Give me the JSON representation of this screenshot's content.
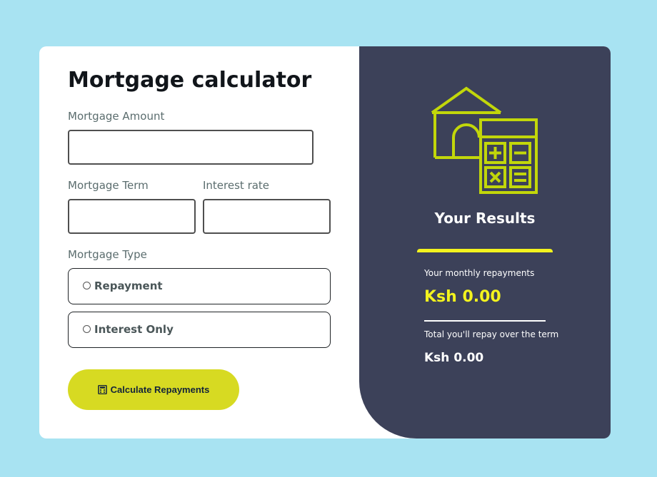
{
  "form": {
    "title": "Mortgage calculator",
    "amount_label": "Mortgage Amount",
    "amount_value": "",
    "term_label": "Mortgage Term",
    "term_value": "",
    "rate_label": "Interest rate",
    "rate_value": "",
    "type_label": "Mortgage Type",
    "type_options": [
      {
        "label": "Repayment",
        "checked": false
      },
      {
        "label": "Interest Only",
        "checked": false
      }
    ],
    "calculate_label": "Calculate Repayments",
    "calculate_icon": "calculator-icon"
  },
  "results": {
    "illustration_icon": "house-calculator-icon",
    "title": "Your Results",
    "monthly_label": "Your monthly repayments",
    "monthly_value": "Ksh 0.00",
    "total_label": "Total you'll repay over the term",
    "total_value": "Ksh 0.00"
  },
  "colors": {
    "page_background": "#a8e3f2",
    "results_background": "#3c4159",
    "accent_lime": "#d7da22",
    "accent_yellow": "#f3f31e",
    "illustration": "#c2d70a"
  }
}
